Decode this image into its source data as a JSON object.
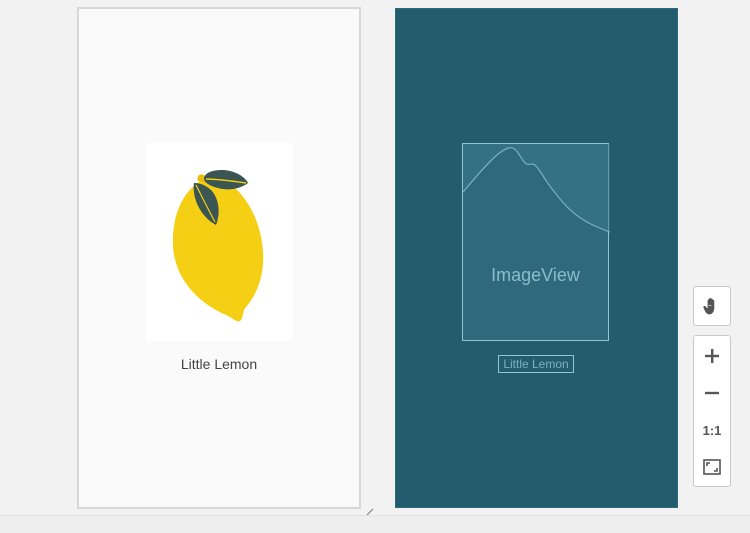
{
  "design_view": {
    "image": {
      "icon": "lemon-illustration",
      "colors": {
        "lemon": "#f5cf14",
        "leaf": "#3b5552"
      }
    },
    "label": "Little Lemon"
  },
  "blueprint_view": {
    "image_label": "ImageView",
    "text_label": "Little Lemon",
    "colors": {
      "background": "#235c6d",
      "outline": "#8fc6d6"
    }
  },
  "toolbar": {
    "pan": {
      "icon": "hand-icon"
    },
    "zoom_in": {
      "icon": "plus-icon"
    },
    "zoom_out": {
      "icon": "minus-icon"
    },
    "actual_size": {
      "label": "1:1"
    },
    "fit_screen": {
      "icon": "fit-screen-icon"
    }
  }
}
